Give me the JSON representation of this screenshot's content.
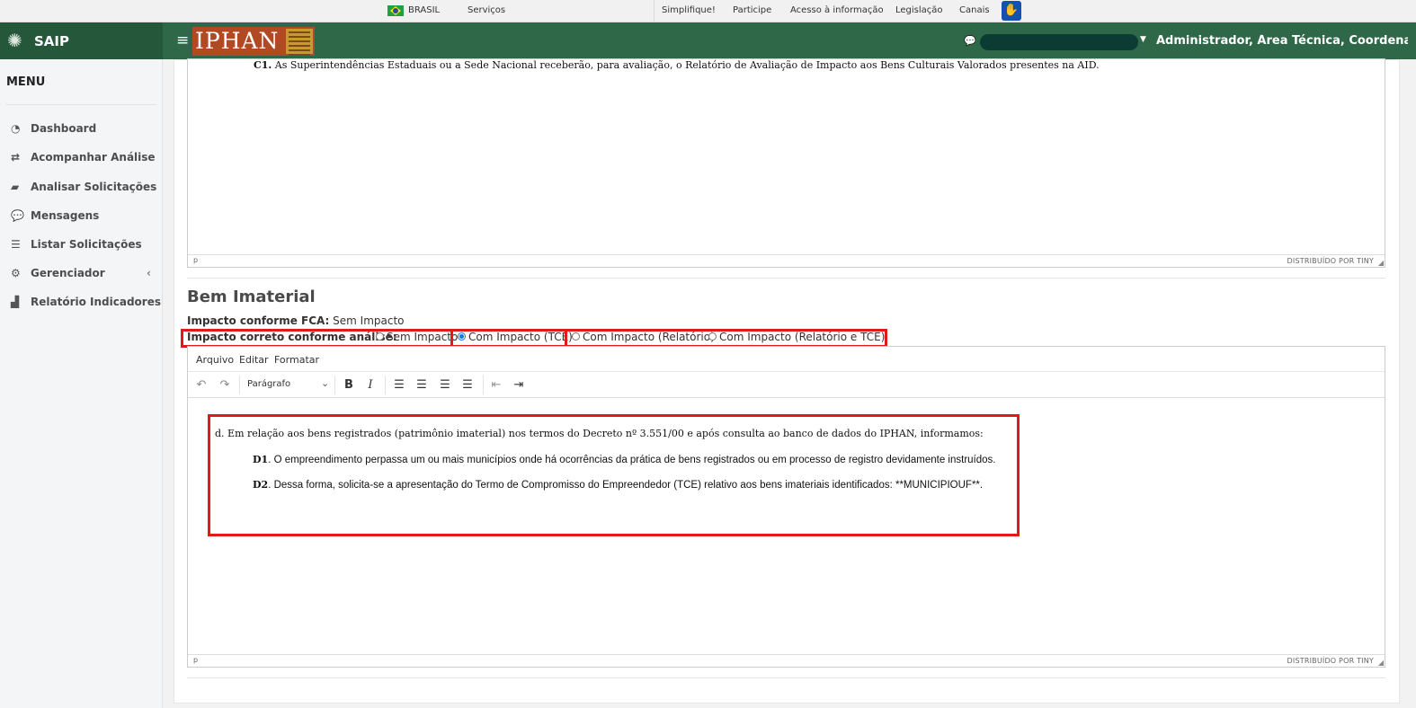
{
  "gov_bar": {
    "country": "BRASIL",
    "services": "Serviços",
    "links": [
      "Simplifique!",
      "Participe",
      "Acesso à informação",
      "Legislação",
      "Canais"
    ]
  },
  "header": {
    "app_name": "SAIP",
    "logo_text": "IPHAN",
    "user_roles": "Administrador, Área Técnica, Coordenação..."
  },
  "sidebar": {
    "title": "MENU",
    "items": [
      {
        "label": "Dashboard",
        "icon": "dashboard-icon"
      },
      {
        "label": "Acompanhar Análise",
        "icon": "exchange-icon"
      },
      {
        "label": "Analisar Solicitações",
        "icon": "book-icon"
      },
      {
        "label": "Mensagens",
        "icon": "comments-icon"
      },
      {
        "label": "Listar Solicitações",
        "icon": "list-icon"
      },
      {
        "label": "Gerenciador",
        "icon": "cogs-icon"
      },
      {
        "label": "Relatório Indicadores",
        "icon": "area-chart-icon"
      }
    ]
  },
  "editor_top": {
    "c1_prefix": "C1.",
    "c1_text": " As Superintendências Estaduais ou a Sede Nacional receberão, para avaliação, o Relatório de Avaliação de Impacto aos Bens Culturais Valorados presentes na AID.",
    "status_path": "p",
    "status_brand": "DISTRIBUÍDO POR TINY"
  },
  "section": {
    "title": "Bem Imaterial",
    "fca_label": "Impacto conforme FCA:",
    "fca_value": " Sem Impacto",
    "impact_label": "Impacto correto conforme análise:",
    "options": [
      {
        "label": "Sem Impacto",
        "selected": false
      },
      {
        "label": "Com Impacto (TCE)",
        "selected": true
      },
      {
        "label": "Com Impacto (Relatório)",
        "selected": false
      },
      {
        "label": "Com Impacto (Relatório e TCE)",
        "selected": false
      }
    ]
  },
  "editor_bottom": {
    "menu": [
      "Arquivo",
      "Editar",
      "Formatar"
    ],
    "format_select": "Parágrafo",
    "d_text": "d. Em relação aos bens registrados (patrimônio imaterial) nos termos do Decreto nº 3.551/00 e após consulta ao banco de dados do IPHAN, informamos:",
    "d1_prefix": "D1",
    "d1_text": ". O empreendimento perpassa um ou mais municípios onde há ocorrências da prática de bens registrados ou em processo de registro devidamente instruídos.",
    "d2_prefix": "D2",
    "d2_text": ". Dessa forma, solicita-se a apresentação do Termo de Compromisso do Empreendedor (TCE) relativo aos bens imateriais identificados: **MUNICIPIOUF**.",
    "status_path": "p",
    "status_brand": "DISTRIBUÍDO POR TINY"
  }
}
